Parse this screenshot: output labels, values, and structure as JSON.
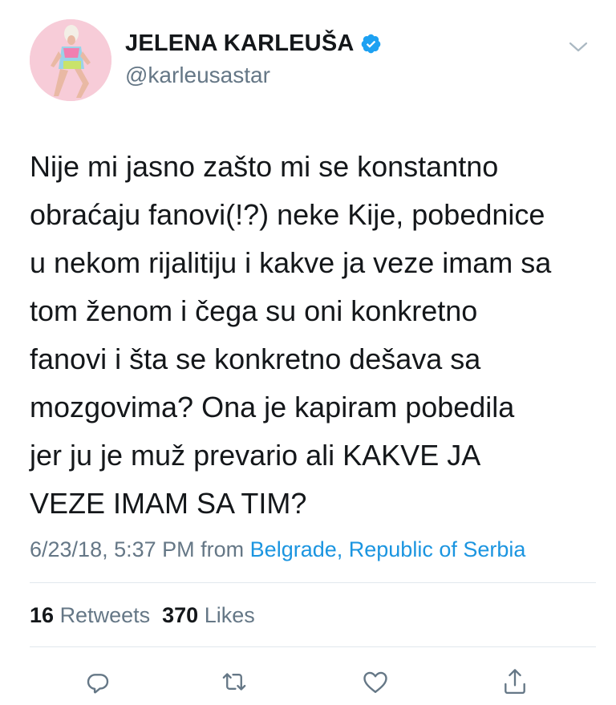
{
  "user": {
    "display_name": "JELENA KARLEUŠA",
    "handle": "@karleusastar",
    "verified": true,
    "avatar_icon": "profile-photo"
  },
  "tweet": {
    "lines": [
      "Nije mi jasno zašto mi se konstantno",
      "obraćaju fanovi(!?) neke Kije, pobednice",
      "u nekom rijalitiju i kakve ja veze imam sa",
      "tom ženom i čega su oni konkretno",
      "fanovi i šta se konkretno dešava sa",
      "mozgovima? Ona je kapiram pobedila",
      "jer ju je muž prevario ali KAKVE JA",
      "VEZE IMAM SA TIM?"
    ],
    "timestamp": "6/23/18, 5:37 PM",
    "from_label": "from",
    "location": "Belgrade, Republic of Serbia"
  },
  "stats": {
    "retweets_count": "16",
    "retweets_label": "Retweets",
    "likes_count": "370",
    "likes_label": "Likes"
  },
  "actions": [
    {
      "icon": "reply-icon"
    },
    {
      "icon": "retweet-icon"
    },
    {
      "icon": "like-icon"
    },
    {
      "icon": "share-icon"
    }
  ],
  "colors": {
    "link": "#1b95e0",
    "muted": "#657786",
    "text": "#14171a",
    "verified": "#1da1f2",
    "divider": "#e1e8ed"
  }
}
